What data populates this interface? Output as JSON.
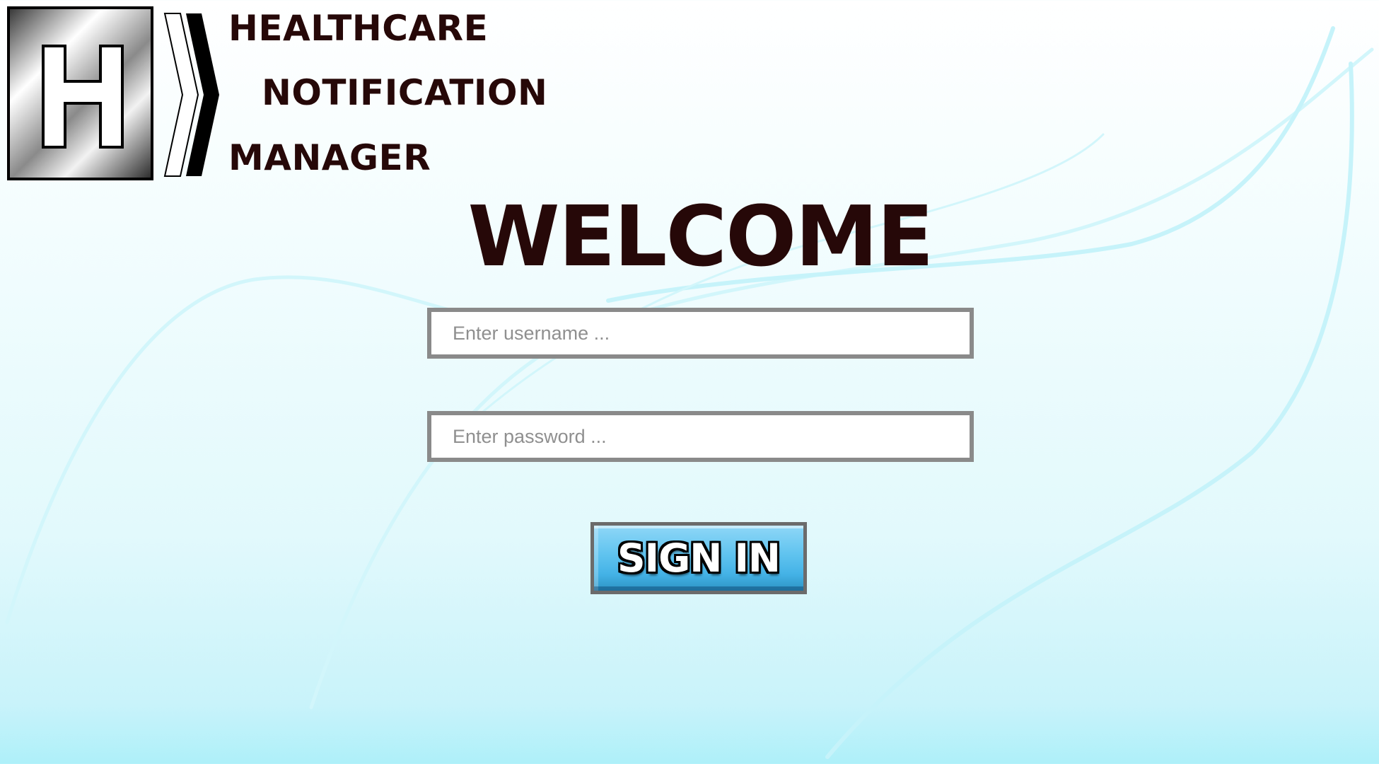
{
  "logo": {
    "letter": "H",
    "icon": "hospital-h-logo"
  },
  "brand": {
    "line1": "HEALTHCARE",
    "line2": "NOTIFICATION",
    "line3": "MANAGER"
  },
  "welcome": "WELCOME",
  "login": {
    "username_placeholder": "Enter username ...",
    "password_placeholder": "Enter password ...",
    "signin_label": "SIGN IN"
  },
  "colors": {
    "title_text": "#260808",
    "button_blue": "#5fc3ef",
    "field_border": "#8a8a8a",
    "background_bottom": "#aef0f9"
  }
}
